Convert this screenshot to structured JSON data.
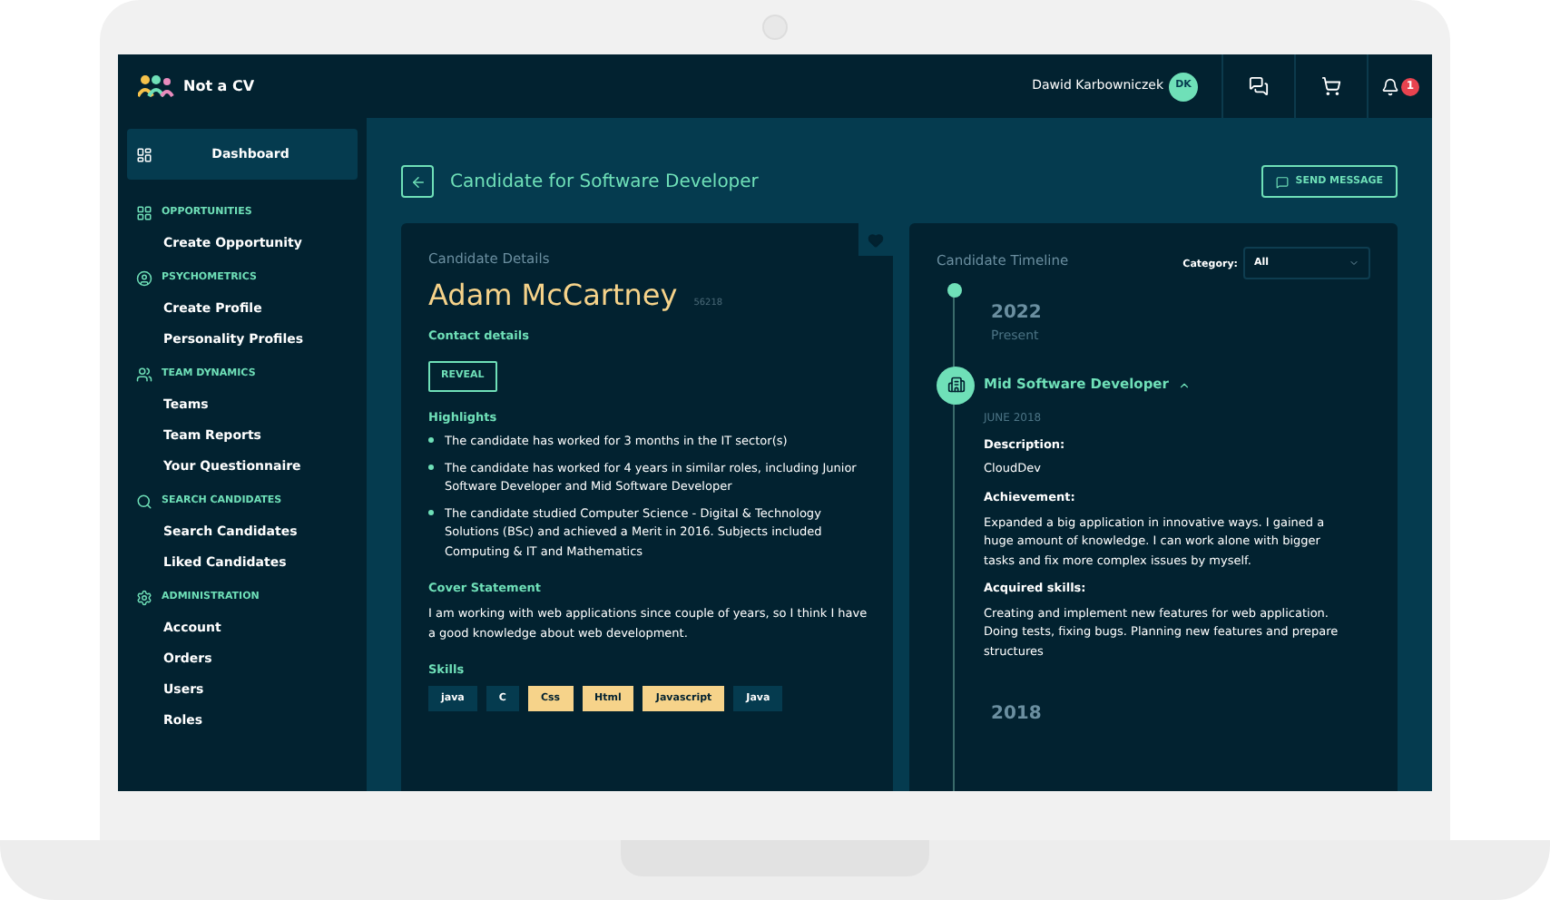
{
  "header": {
    "brand": "Not a CV",
    "user": "Dawid Karbowniczek",
    "avatar": "DK",
    "notifications": "1"
  },
  "sidebar": {
    "items": [
      {
        "label": "Dashboard",
        "kind": "main",
        "selected": true
      },
      {
        "label": "OPPORTUNITIES",
        "kind": "section"
      },
      {
        "label": "Create Opportunity",
        "kind": "link",
        "selected": false
      },
      {
        "label": "PSYCHOMETRICS",
        "kind": "section"
      },
      {
        "label": "Create Profile",
        "kind": "link",
        "selected": false
      },
      {
        "label": "Personality Profiles",
        "kind": "link",
        "selected": false
      },
      {
        "label": "TEAM DYNAMICS",
        "kind": "section"
      },
      {
        "label": "Teams",
        "kind": "link",
        "selected": false
      },
      {
        "label": "Team Reports",
        "kind": "link",
        "selected": false
      },
      {
        "label": "Your Questionnaire",
        "kind": "link",
        "selected": false
      },
      {
        "label": "SEARCH CANDIDATES",
        "kind": "section"
      },
      {
        "label": "Search Candidates",
        "kind": "link",
        "selected": false
      },
      {
        "label": "Liked Candidates",
        "kind": "link",
        "selected": false
      },
      {
        "label": "ADMINISTRATION",
        "kind": "section"
      },
      {
        "label": "Account",
        "kind": "link",
        "selected": false
      },
      {
        "label": "Orders",
        "kind": "link",
        "selected": false
      },
      {
        "label": "Users",
        "kind": "link",
        "selected": false
      },
      {
        "label": "Roles",
        "kind": "link",
        "selected": false
      }
    ]
  },
  "page": {
    "title": "Candidate for Software Developer",
    "send_button": "SEND MESSAGE"
  },
  "details": {
    "heading": "Candidate Details",
    "name": "Adam McCartney",
    "id": "56218",
    "liked": true,
    "contact_label": "Contact details",
    "reveal": "REVEAL",
    "highlights_label": "Highlights",
    "highlights": [
      "The candidate has worked for 3 months in the IT sector(s)",
      "The candidate has worked for 4 years in similar roles, including Junior Software Developer and Mid Software Developer",
      "The candidate studied Computer Science - Digital & Technology Solutions (BSc) and achieved a Merit in 2016. Subjects included Computing & IT and Mathematics"
    ],
    "cover_label": "Cover Statement",
    "cover": "I am working with web applications since couple of years, so I think I have a good knowledge about web development.",
    "skills_label": "Skills",
    "skills": [
      {
        "label": "java",
        "matched": false
      },
      {
        "label": "C",
        "matched": false
      },
      {
        "label": "Css",
        "matched": true
      },
      {
        "label": "Html",
        "matched": true
      },
      {
        "label": "Javascript",
        "matched": true
      },
      {
        "label": "Java",
        "matched": false
      }
    ]
  },
  "timeline": {
    "heading": "Candidate Timeline",
    "category_label": "Category:",
    "category_value": "All",
    "year": "2022",
    "year_sub": "Present",
    "entry": {
      "title": "Mid Software Developer",
      "expanded": true,
      "date": "JUNE 2018",
      "sections": [
        {
          "label": "Description:",
          "text": "CloudDev"
        },
        {
          "label": "Achievement:",
          "text": "Expanded a big application in innovative ways. I gained a huge amount of knowledge. I can work alone with bigger tasks and fix more complex issues by myself."
        },
        {
          "label": "Acquired skills:",
          "text": "Creating and implement new features for web application. Doing tests, fixing bugs. Planning new features and prepare structures"
        }
      ]
    },
    "next_year": "2018"
  }
}
